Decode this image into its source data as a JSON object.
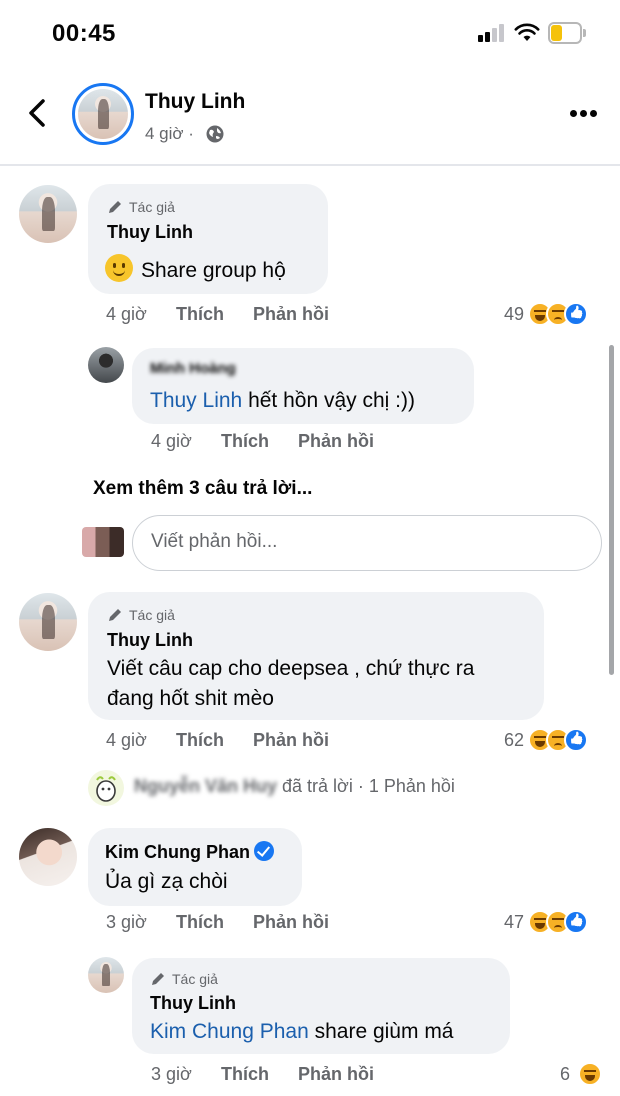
{
  "status_bar": {
    "time": "00:45"
  },
  "header": {
    "name": "Thuy Linh",
    "time": "4 giờ ·"
  },
  "author_badge": "Tác giả",
  "actions": {
    "like": "Thích",
    "reply": "Phản hồi"
  },
  "comments": [
    {
      "name": "Thuy Linh",
      "text": "Share group hộ",
      "time": "4 giờ",
      "reaction_count": "49",
      "reactions": [
        "haha-icon",
        "sad-icon",
        "like-icon"
      ]
    },
    {
      "name": "Thuy Linh",
      "text_line1": "Viết câu cap cho deepsea , chứ thực ra",
      "text_line2": "đang hốt shit mèo",
      "time": "4 giờ",
      "reaction_count": "62",
      "reactions": [
        "haha-icon",
        "sad-icon",
        "like-icon"
      ]
    },
    {
      "name": "Kim Chung Phan",
      "text": "Ủa gì zạ chòi",
      "time": "3 giờ",
      "reaction_count": "47",
      "reactions": [
        "haha-icon",
        "sad-icon",
        "like-icon"
      ]
    }
  ],
  "replies": [
    {
      "name": "Minh Hoàng",
      "mention": "Thuy Linh",
      "text": " hết hồn vậy chị :))",
      "time": "4 giờ"
    },
    {
      "name": "Thuy Linh",
      "mention": "Kim Chung Phan",
      "text": " share giùm má",
      "time": "3 giờ",
      "reaction_count": "6"
    }
  ],
  "view_more": "Xem thêm 3 câu trả lời...",
  "reply_input": {
    "placeholder": "Viết phản hồi..."
  },
  "replied_notice": {
    "name": "Nguyễn Văn Huy",
    "text": " đã trả lời · 1 Phản hồi"
  },
  "colors": {
    "accent": "#1877f2",
    "mention": "#1b5fad",
    "bubble": "#f0f2f5",
    "meta": "#65676b"
  }
}
